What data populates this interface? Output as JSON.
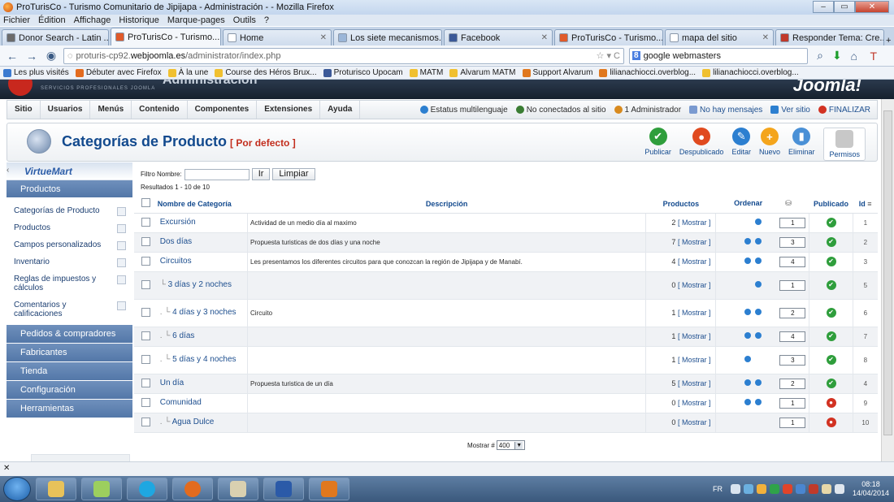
{
  "window": {
    "title": "ProTurisCo - Turismo Comunitario de Jipijapa - Administración - - Mozilla Firefox"
  },
  "menubar": [
    "Fichier",
    "Édition",
    "Affichage",
    "Historique",
    "Marque-pages",
    "Outils",
    "?"
  ],
  "tabs": [
    {
      "label": "Donor Search - Latin ...",
      "color": "#6b6b6b"
    },
    {
      "label": "ProTurisCo - Turismo...",
      "color": "#e05a2a",
      "active": true
    },
    {
      "label": "Home",
      "color": "#ffffff"
    },
    {
      "label": "Los siete mecanismos...",
      "color": "#9bb6d8"
    },
    {
      "label": "Facebook",
      "color": "#3b5998"
    },
    {
      "label": "ProTurisCo - Turismo...",
      "color": "#e05a2a"
    },
    {
      "label": "mapa del sitio",
      "color": "#ffffff"
    },
    {
      "label": "Responder Tema: Cre...",
      "color": "#c0392b"
    }
  ],
  "address": {
    "prefix": "proturis-cp92.",
    "domain": "webjoomla.es",
    "path": "/administrator/index.php"
  },
  "search": {
    "engine": "8",
    "value": "google webmasters"
  },
  "bookmarks": [
    "Les plus visités",
    "Débuter avec Firefox",
    "À la une",
    "Course des Héros Brux...",
    "Proturisco Upocam",
    "MATM",
    "Alvarum MATM",
    "Support Alvarum",
    "lilianachiocci.overblog...",
    "lilianachiocci.overblog..."
  ],
  "joomla_header": {
    "sub": "SERVICIOS PROFESIONALES JOOMLA",
    "admin": "Administración",
    "logo": "Joomla!"
  },
  "joomla_menu": [
    "Sitio",
    "Usuarios",
    "Menús",
    "Contenido",
    "Componentes",
    "Extensiones",
    "Ayuda"
  ],
  "joomla_status": {
    "multi": "Estatus multilenguaje",
    "site": "No conectados al sitio",
    "admin": "1 Administrador",
    "msg": "No hay mensajes",
    "view": "Ver sitio",
    "logout": "FINALIZAR"
  },
  "page": {
    "title": "Categorías de Producto",
    "subtitle": "[ Por defecto ]"
  },
  "toolbar": [
    {
      "label": "Publicar",
      "color": "#2f9e3c",
      "glyph": "✔"
    },
    {
      "label": "Despublicado",
      "color": "#e04a1f",
      "glyph": "●"
    },
    {
      "label": "Editar",
      "color": "#2c7fd0",
      "glyph": "✎"
    },
    {
      "label": "Nuevo",
      "color": "#f4a51c",
      "glyph": "+"
    },
    {
      "label": "Eliminar",
      "color": "#4a90d6",
      "glyph": "▮"
    }
  ],
  "toolbar_perm": "Permisos",
  "sidebar": {
    "brand": "VirtueMart",
    "top_section": "Productos",
    "items": [
      {
        "label": "Categorías de Producto"
      },
      {
        "label": "Productos"
      },
      {
        "label": "Campos personalizados"
      },
      {
        "label": "Inventario"
      },
      {
        "label": "Reglas de impuestos y cálculos"
      },
      {
        "label": "Comentarios y calificaciones"
      }
    ],
    "sections": [
      "Pedidos & compradores",
      "Fabricantes",
      "Tienda",
      "Configuración",
      "Herramientas"
    ]
  },
  "filter": {
    "label": "Filtro Nombre:",
    "go": "Ir",
    "clear": "Limpiar",
    "results": "Resultados 1 - 10 de 10"
  },
  "table": {
    "headers": {
      "name": "Nombre de Categoría",
      "desc": "Descripción",
      "products": "Productos",
      "order": "Ordenar",
      "published": "Publicado",
      "id": "Id"
    },
    "rows": [
      {
        "name": "Excursión",
        "indent": "",
        "desc": "Actividad de un medio día al maximo",
        "count": "2",
        "show": "[ Mostrar ]",
        "up": false,
        "down": true,
        "order": "1",
        "pub": true,
        "id": "1"
      },
      {
        "name": "Dos días",
        "indent": "",
        "desc": "Propuesta turisticas de dos días y una noche",
        "count": "7",
        "show": "[ Mostrar ]",
        "up": true,
        "down": true,
        "order": "3",
        "pub": true,
        "id": "2"
      },
      {
        "name": "Circuitos",
        "indent": "",
        "desc": "Les presentamos los diferentes circuitos para que conozcan la región de Jipijapa y de Manabí.",
        "count": "4",
        "show": "[ Mostrar ]",
        "up": true,
        "down": true,
        "order": "4",
        "pub": true,
        "id": "3"
      },
      {
        "name": "3 días y 2 noches",
        "indent": "└",
        "desc": "",
        "count": "0",
        "show": "[ Mostrar ]",
        "up": false,
        "down": true,
        "order": "1",
        "pub": true,
        "id": "5"
      },
      {
        "name": "4 días y 3 noches",
        "indent": ". └",
        "desc": "Circuito",
        "count": "1",
        "show": "[ Mostrar ]",
        "up": true,
        "down": true,
        "order": "2",
        "pub": true,
        "id": "6"
      },
      {
        "name": "6 días",
        "indent": ". └",
        "desc": "",
        "count": "1",
        "show": "[ Mostrar ]",
        "up": true,
        "down": true,
        "order": "4",
        "pub": true,
        "id": "7"
      },
      {
        "name": "5 días y 4 noches",
        "indent": ". └",
        "desc": "",
        "count": "1",
        "show": "[ Mostrar ]",
        "up": true,
        "down": false,
        "order": "3",
        "pub": true,
        "id": "8"
      },
      {
        "name": "Un día",
        "indent": "",
        "desc": "Propuesta turistica de un día",
        "count": "5",
        "show": "[ Mostrar ]",
        "up": true,
        "down": true,
        "order": "2",
        "pub": true,
        "id": "4"
      },
      {
        "name": "Comunidad",
        "indent": "",
        "desc": "",
        "count": "0",
        "show": "[ Mostrar ]",
        "up": true,
        "down": true,
        "order": "1",
        "pub": false,
        "id": "9"
      },
      {
        "name": "Agua Dulce",
        "indent": ". └",
        "desc": "",
        "count": "0",
        "show": "[ Mostrar ]",
        "up": false,
        "down": false,
        "order": "1",
        "pub": false,
        "id": "10"
      }
    ]
  },
  "pager": {
    "label": "Mostrar #",
    "value": "400"
  },
  "taskbar": {
    "lang": "FR",
    "time": "08:18",
    "date": "14/04/2014"
  }
}
